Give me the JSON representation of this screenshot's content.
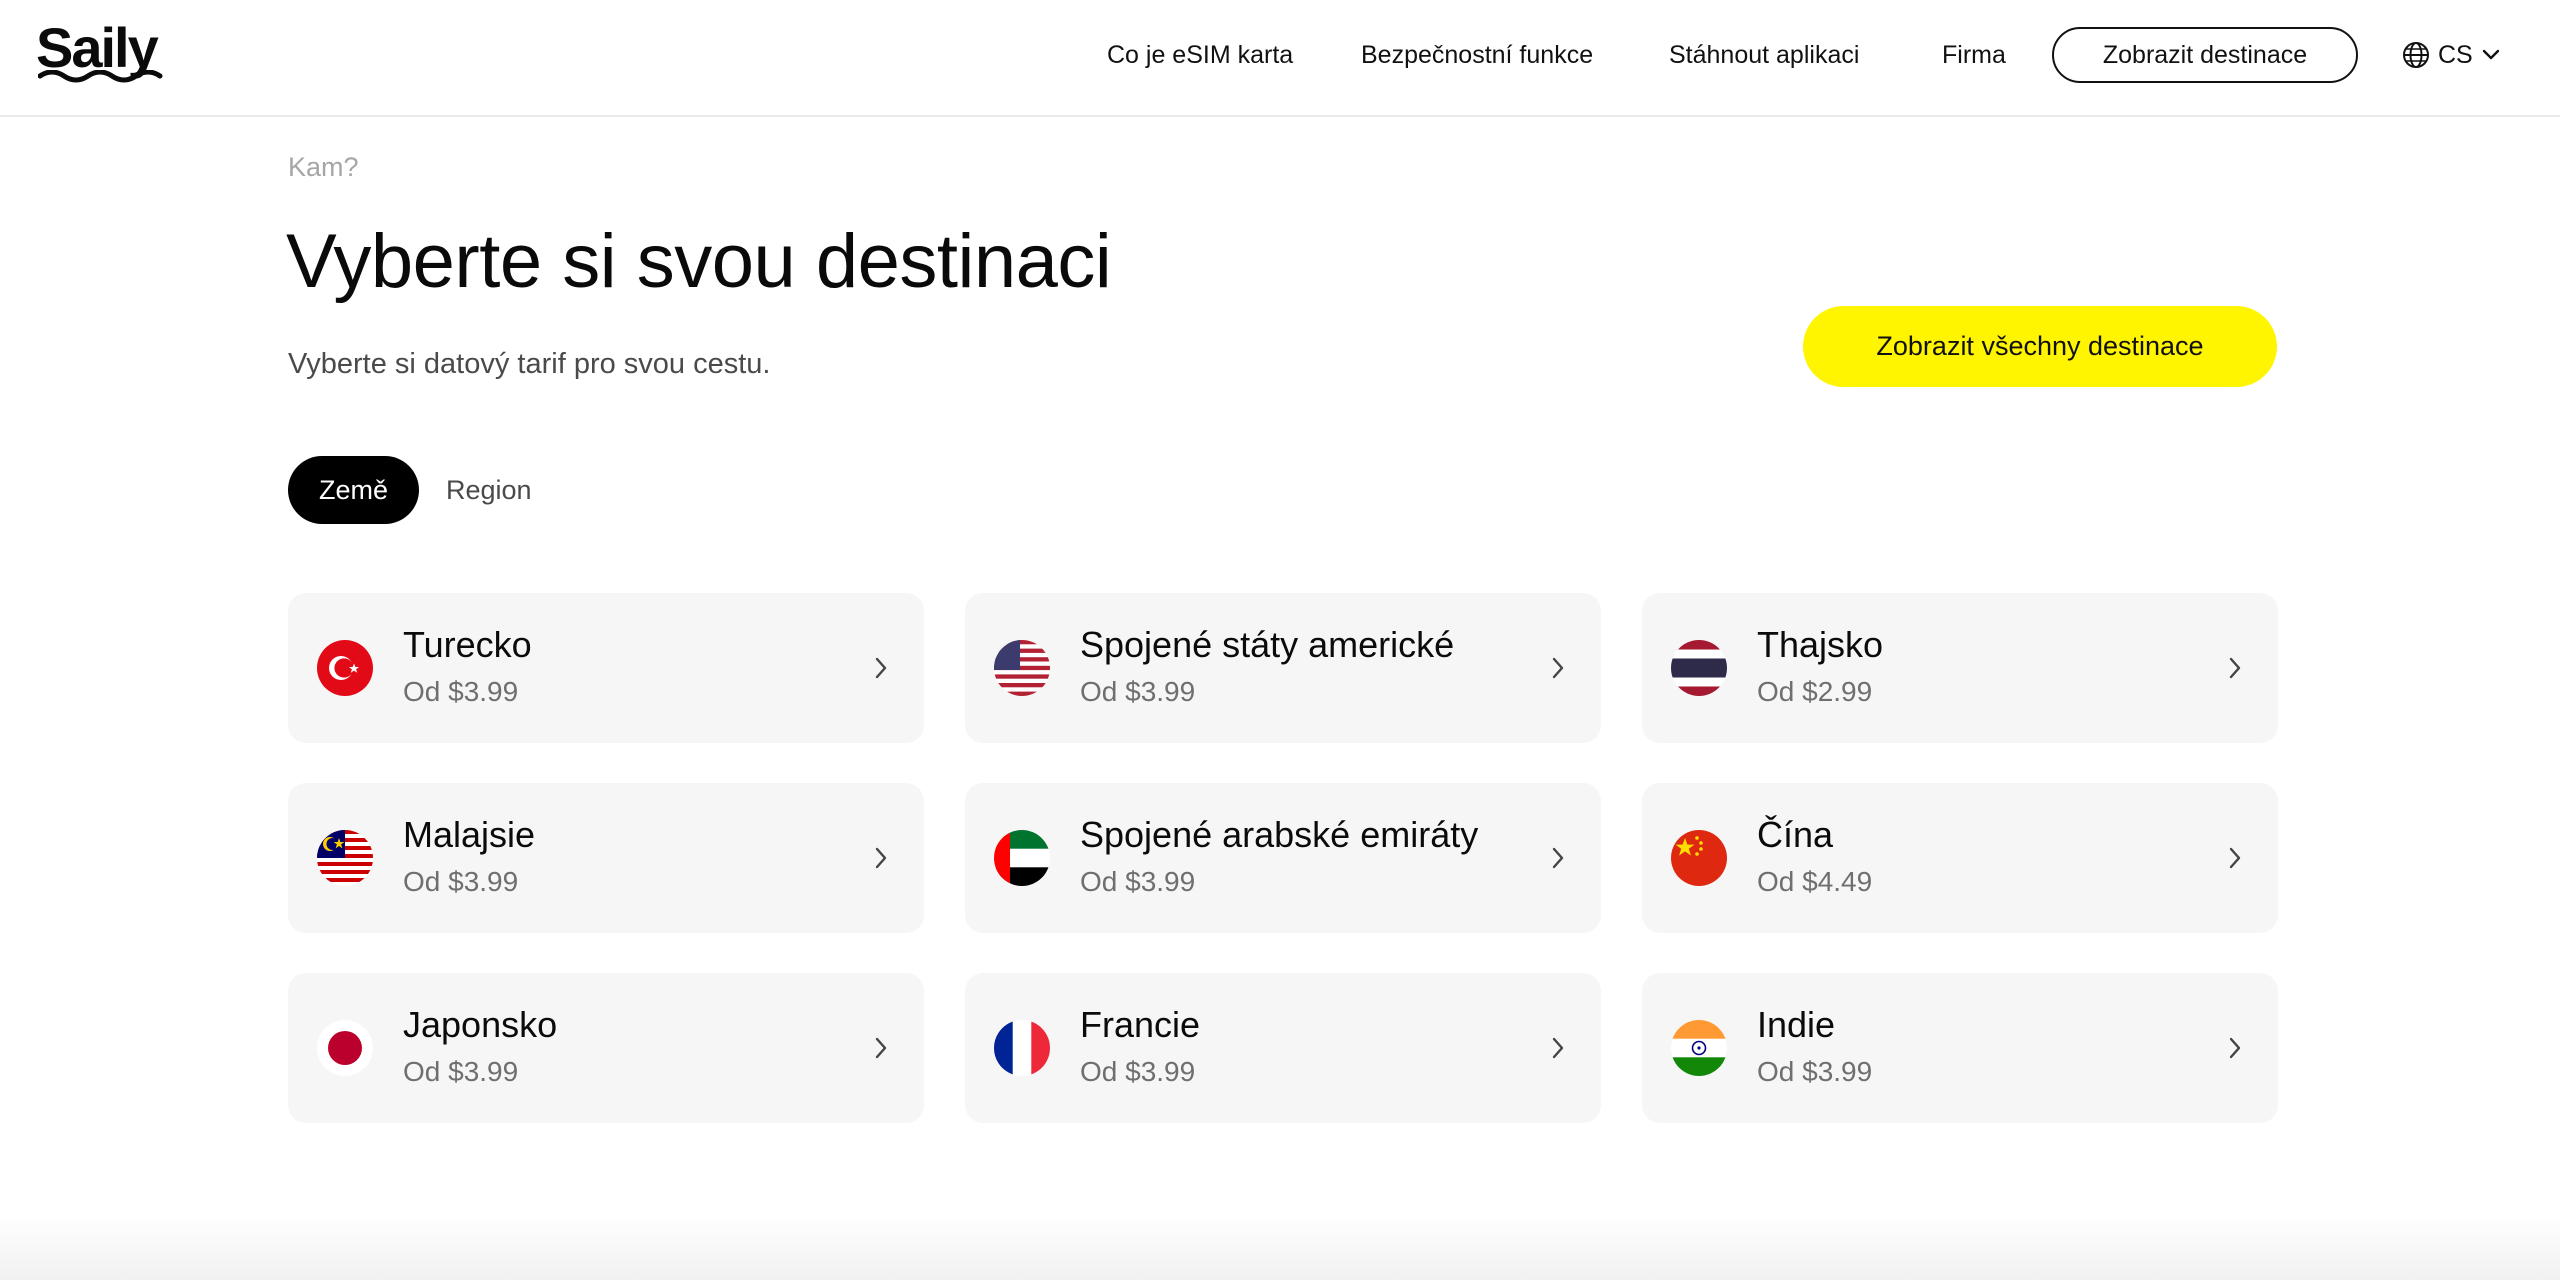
{
  "header": {
    "logo": "Saily",
    "nav": [
      "Co je eSIM karta",
      "Bezpečnostní funkce",
      "Stáhnout aplikaci",
      "Firma"
    ],
    "cta_label": "Zobrazit destinace",
    "language": "CS",
    "language_icon": "globe-icon"
  },
  "main": {
    "kicker": "Kam?",
    "title": "Vyberte si svou destinaci",
    "subtitle": "Vyberte si datový tarif pro svou cestu.",
    "all_destinations_label": "Zobrazit všechny destinace",
    "tabs": [
      {
        "label": "Země",
        "active": true
      },
      {
        "label": "Region",
        "active": false
      }
    ],
    "destinations": [
      {
        "name": "Turecko",
        "price": "Od $3.99",
        "flag": "turkey-flag-icon"
      },
      {
        "name": "Spojené státy americké",
        "price": "Od $3.99",
        "flag": "usa-flag-icon"
      },
      {
        "name": "Thajsko",
        "price": "Od $2.99",
        "flag": "thailand-flag-icon"
      },
      {
        "name": "Malajsie",
        "price": "Od $3.99",
        "flag": "malaysia-flag-icon"
      },
      {
        "name": "Spojené arabské emiráty",
        "price": "Od $3.99",
        "flag": "uae-flag-icon"
      },
      {
        "name": "Čína",
        "price": "Od $4.49",
        "flag": "china-flag-icon"
      },
      {
        "name": "Japonsko",
        "price": "Od $3.99",
        "flag": "japan-flag-icon"
      },
      {
        "name": "Francie",
        "price": "Od $3.99",
        "flag": "france-flag-icon"
      },
      {
        "name": "Indie",
        "price": "Od $3.99",
        "flag": "india-flag-icon"
      }
    ]
  },
  "colors": {
    "accent_yellow": "#fff500",
    "card_bg": "#f6f6f6",
    "text_dark": "#0b0b0b",
    "text_muted": "#6f6f6f"
  }
}
